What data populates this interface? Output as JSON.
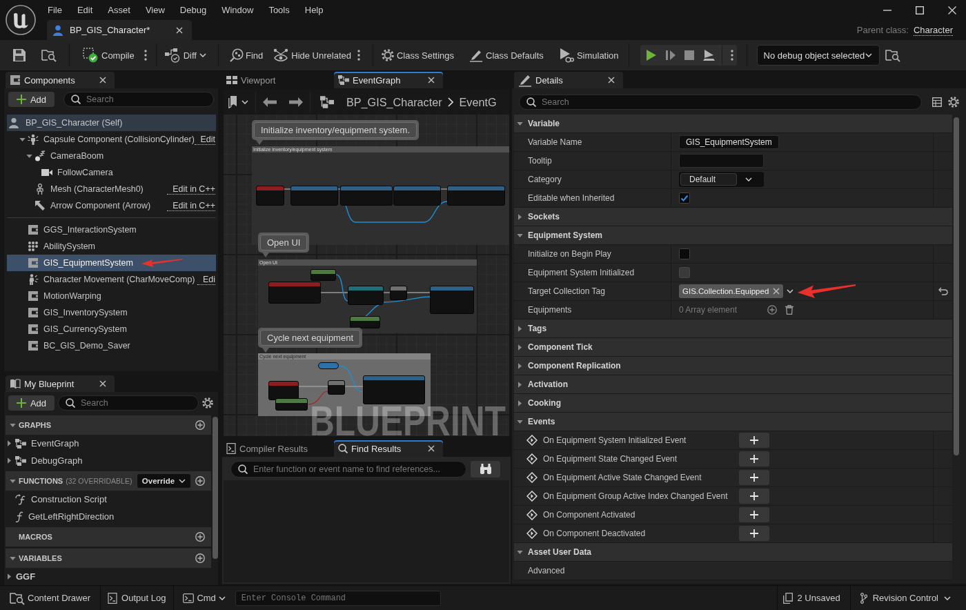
{
  "app": {
    "menu": [
      "File",
      "Edit",
      "Asset",
      "View",
      "Debug",
      "Window",
      "Tools",
      "Help"
    ],
    "tabs": [
      {
        "label": "BP_GIS_Character*",
        "selected": true
      }
    ],
    "parent_class_label": "Parent class:",
    "parent_class": "Character"
  },
  "toolbar": {
    "compile": "Compile",
    "diff": "Diff",
    "find": "Find",
    "hide_unrelated": "Hide Unrelated",
    "class_settings": "Class Settings",
    "class_defaults": "Class Defaults",
    "simulation": "Simulation",
    "debug_object": "No debug object selected"
  },
  "components": {
    "tab": "Components",
    "add": "Add",
    "search_placeholder": "Search",
    "root": {
      "label": "BP_GIS_Character (Self)",
      "children": [
        {
          "label": "Capsule Component (CollisionCylinder)",
          "kind": "capsule",
          "link": "Edit",
          "expanded": true,
          "selected": false,
          "children": [
            {
              "label": "CameraBoom",
              "kind": "spring_arm",
              "expanded": true,
              "selected": false,
              "children": [
                {
                  "label": "FollowCamera",
                  "kind": "camera",
                  "selected": false
                }
              ]
            },
            {
              "label": "Mesh (CharacterMesh0)",
              "kind": "mesh",
              "link": "Edit in C++",
              "selected": false
            },
            {
              "label": "Arrow Component (Arrow)",
              "kind": "arrow",
              "link": "Edit in C++",
              "selected": false
            }
          ]
        }
      ]
    },
    "items": [
      {
        "label": "GGS_InteractionSystem",
        "kind": "component",
        "selected": false,
        "annotated": false
      },
      {
        "label": "AbilitySystem",
        "kind": "ability",
        "selected": false,
        "annotated": false
      },
      {
        "label": "GIS_EquipmentSystem",
        "kind": "component",
        "selected": true,
        "annotated": true
      },
      {
        "label": "Character Movement (CharMoveComp)",
        "kind": "movement",
        "link": "Edi",
        "selected": false,
        "annotated": false
      },
      {
        "label": "MotionWarping",
        "kind": "component",
        "selected": false,
        "annotated": false
      },
      {
        "label": "GIS_InventorySystem",
        "kind": "component",
        "selected": false,
        "annotated": false
      },
      {
        "label": "GIS_CurrencySystem",
        "kind": "component",
        "selected": false,
        "annotated": false
      },
      {
        "label": "BC_GIS_Demo_Saver",
        "kind": "component",
        "selected": false,
        "annotated": false
      }
    ]
  },
  "my_blueprint": {
    "tab": "My Blueprint",
    "add": "Add",
    "search_placeholder": "Search",
    "sections": [
      {
        "title": "GRAPHS",
        "expanded": true,
        "items": [
          {
            "label": "EventGraph",
            "kind": "graph",
            "expanded": false,
            "selected": false
          },
          {
            "label": "DebugGraph",
            "kind": "graph",
            "expanded": false,
            "selected": false
          }
        ]
      },
      {
        "title": "FUNCTIONS",
        "note": "(32 OVERRIDABLE)",
        "override": "Override",
        "expanded": true,
        "items": [
          {
            "label": "Construction Script",
            "kind": "construction",
            "selected": false
          },
          {
            "label": "GetLeftRightDirection",
            "kind": "function",
            "selected": false
          }
        ]
      },
      {
        "title": "MACROS"
      },
      {
        "title": "VARIABLES",
        "expanded": true,
        "items": [
          {
            "label": "GGF",
            "kind": "category",
            "expanded": false,
            "selected": false
          }
        ]
      }
    ]
  },
  "graph_editor": {
    "tabs": [
      {
        "label": "Viewport",
        "kind": "viewport",
        "selected": false
      },
      {
        "label": "EventGraph",
        "kind": "graph",
        "selected": true
      }
    ],
    "breadcrumb": [
      "BP_GIS_Character",
      "EventG"
    ],
    "comments": [
      {
        "bubble": "Initialize inventory/equipment system.",
        "header": "Initialize inventory/equipment system",
        "color": "#2f2f2f"
      },
      {
        "bubble": "Open UI",
        "header": "Open UI",
        "color": "#2f2f2f"
      },
      {
        "bubble": "Cycle next equipment",
        "header": "Cycle next equipment",
        "color": "#6b6b6b"
      }
    ],
    "watermark": "BLUEPRINT"
  },
  "results_panel": {
    "tabs": [
      {
        "label": "Compiler Results",
        "kind": "compiler",
        "selected": false
      },
      {
        "label": "Find Results",
        "kind": "find",
        "selected": true
      }
    ],
    "search_placeholder": "Enter function or event name to find references..."
  },
  "details": {
    "tab": "Details",
    "search_placeholder": "Search",
    "sections": [
      {
        "title": "Variable",
        "expanded": true,
        "rows": [
          {
            "label": "Variable Name",
            "kind": "text",
            "value": "GIS_EquipmentSystem"
          },
          {
            "label": "Tooltip",
            "kind": "text"
          },
          {
            "label": "Category",
            "kind": "combo",
            "value": "Default"
          },
          {
            "label": "Editable when Inherited",
            "kind": "checkbox",
            "checked": true,
            "disabled": false
          }
        ]
      },
      {
        "title": "Sockets",
        "expanded": false
      },
      {
        "title": "Equipment System",
        "expanded": true,
        "rows": [
          {
            "label": "Initialize on Begin Play",
            "kind": "checkbox",
            "checked": false,
            "disabled": false,
            "resettable": false,
            "annotated": false
          },
          {
            "label": "Equipment System Initialized",
            "kind": "checkbox",
            "checked": false,
            "disabled": true,
            "resettable": false,
            "annotated": false
          },
          {
            "label": "Target Collection Tag",
            "kind": "tag",
            "value": "GIS.Collection.Equipped",
            "resettable": true,
            "annotated": true
          },
          {
            "label": "Equipments",
            "kind": "array",
            "value": "0 Array element",
            "resettable": false,
            "annotated": false
          }
        ]
      },
      {
        "title": "Tags",
        "expanded": false
      },
      {
        "title": "Component Tick",
        "expanded": false
      },
      {
        "title": "Component Replication",
        "expanded": false
      },
      {
        "title": "Activation",
        "expanded": false
      },
      {
        "title": "Cooking",
        "expanded": false
      },
      {
        "title": "Events",
        "expanded": true,
        "rows": [
          {
            "label": "On Equipment System Initialized Event",
            "kind": "event"
          },
          {
            "label": "On Equipment State Changed Event",
            "kind": "event"
          },
          {
            "label": "On Equipment Active State Changed Event",
            "kind": "event"
          },
          {
            "label": "On Equipment Group Active Index Changed Event",
            "kind": "event"
          },
          {
            "label": "On Component Activated",
            "kind": "event"
          },
          {
            "label": "On Component Deactivated",
            "kind": "event"
          }
        ]
      },
      {
        "title": "Asset User Data",
        "expanded": true,
        "rows": [
          {
            "label": "Advanced",
            "kind": "group"
          }
        ]
      }
    ]
  },
  "status_bar": {
    "content_drawer": "Content Drawer",
    "output_log": "Output Log",
    "cmd": "Cmd",
    "console_placeholder": "Enter Console Command",
    "unsaved": "2 Unsaved",
    "revision_control": "Revision Control"
  }
}
